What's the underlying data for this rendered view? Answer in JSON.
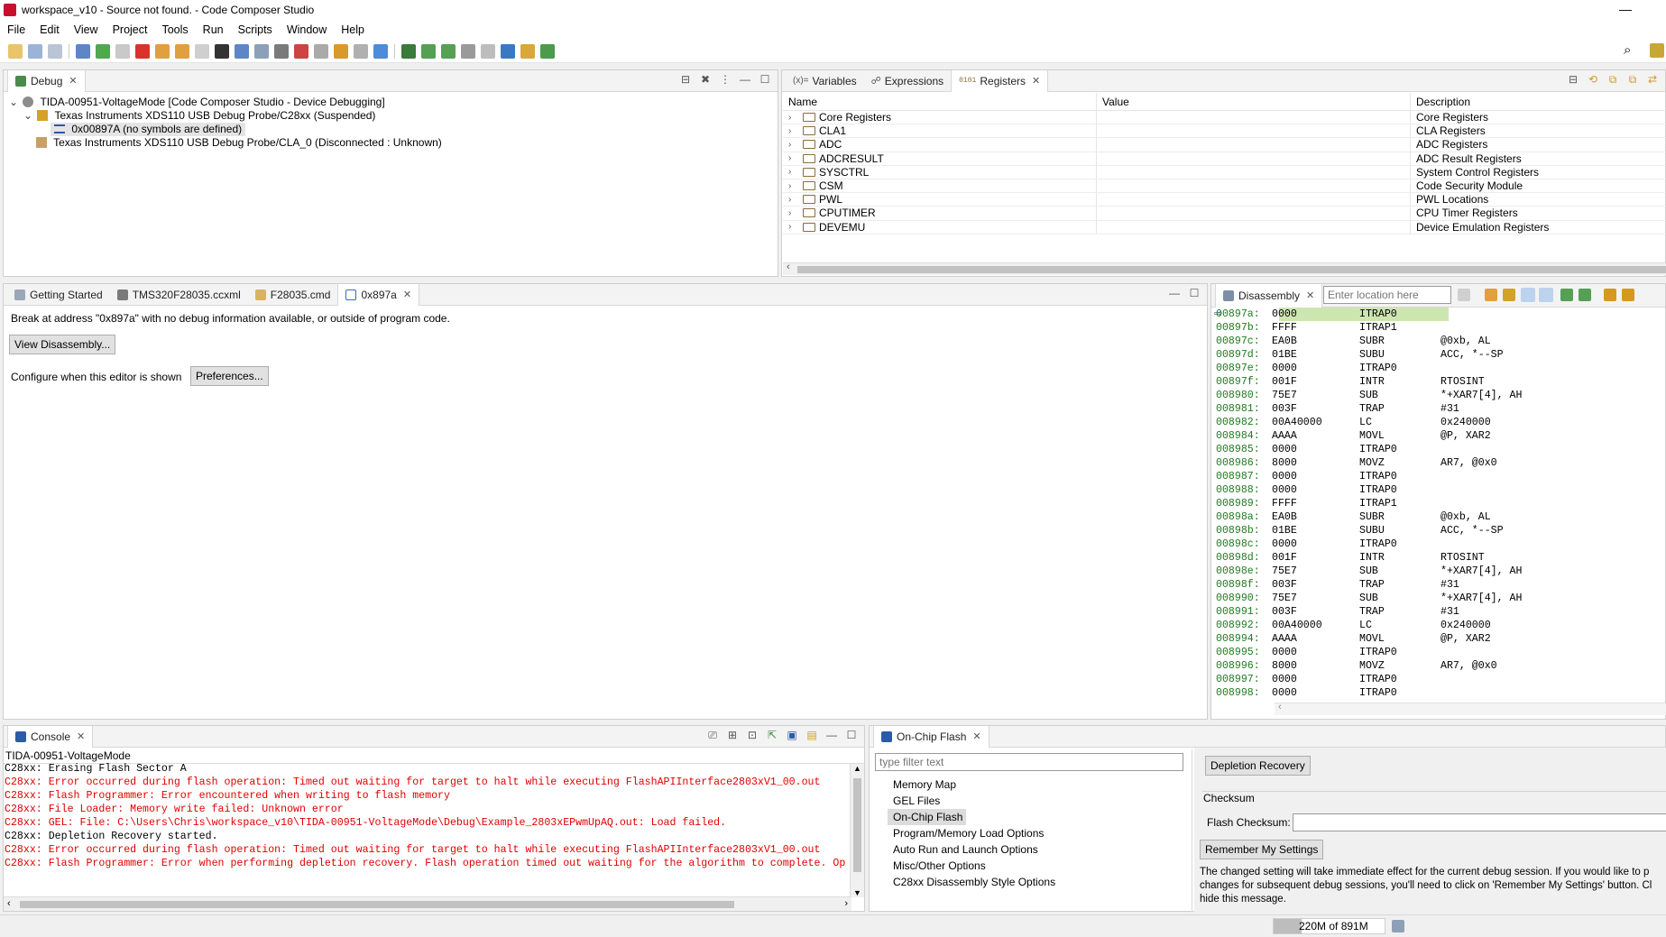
{
  "window": {
    "title": "workspace_v10 - Source not found. - Code Composer Studio",
    "minimize": "—",
    "maximize": "☐",
    "close": "✕"
  },
  "menu": [
    "File",
    "Edit",
    "View",
    "Project",
    "Tools",
    "Run",
    "Scripts",
    "Window",
    "Help"
  ],
  "debug": {
    "tab": "Debug",
    "tree": [
      {
        "label": "TIDA-00951-VoltageMode [Code Composer Studio - Device Debugging]",
        "expander": "⌄"
      },
      {
        "label": "Texas Instruments XDS110 USB Debug Probe/C28xx (Suspended)",
        "expander": "⌄"
      },
      {
        "label": "0x00897A  (no symbols are defined)",
        "expander": ""
      },
      {
        "label": "Texas Instruments XDS110 USB Debug Probe/CLA_0 (Disconnected : Unknown)",
        "expander": ""
      }
    ]
  },
  "registers": {
    "tabs": [
      "Variables",
      "Expressions",
      "Registers"
    ],
    "tab_prefixes": [
      "(x)=",
      "☍",
      "0101"
    ],
    "columns": [
      "Name",
      "Value",
      "Description"
    ],
    "expander": "›",
    "rows": [
      {
        "name": "Core Registers",
        "value": "",
        "desc": "Core Registers"
      },
      {
        "name": "CLA1",
        "value": "",
        "desc": "CLA Registers"
      },
      {
        "name": "ADC",
        "value": "",
        "desc": "ADC Registers"
      },
      {
        "name": "ADCRESULT",
        "value": "",
        "desc": "ADC Result Registers"
      },
      {
        "name": "SYSCTRL",
        "value": "",
        "desc": "System Control Registers"
      },
      {
        "name": "CSM",
        "value": "",
        "desc": "Code Security Module"
      },
      {
        "name": "PWL",
        "value": "",
        "desc": "PWL Locations"
      },
      {
        "name": "CPUTIMER",
        "value": "",
        "desc": "CPU Timer Registers"
      },
      {
        "name": "DEVEMU",
        "value": "",
        "desc": "Device Emulation Registers"
      }
    ]
  },
  "editor": {
    "tabs": [
      "Getting Started",
      "TMS320F28035.ccxml",
      "F28035.cmd",
      "0x897a"
    ],
    "message": "Break at address \"0x897a\" with no debug information available, or outside of program code.",
    "view_disassembly": "View Disassembly...",
    "configure_label": "Configure when this editor is shown",
    "preferences": "Preferences..."
  },
  "disassembly": {
    "tab": "Disassembly",
    "location_placeholder": "Enter location here",
    "pc_marker": "⇨",
    "rows": [
      {
        "addr": "00897a:",
        "op": "0000",
        "mn": "ITRAP0",
        "args": ""
      },
      {
        "addr": "00897b:",
        "op": "FFFF",
        "mn": "ITRAP1",
        "args": ""
      },
      {
        "addr": "00897c:",
        "op": "EA0B",
        "mn": "SUBR",
        "args": "@0xb, AL"
      },
      {
        "addr": "00897d:",
        "op": "01BE",
        "mn": "SUBU",
        "args": "ACC, *--SP"
      },
      {
        "addr": "00897e:",
        "op": "0000",
        "mn": "ITRAP0",
        "args": ""
      },
      {
        "addr": "00897f:",
        "op": "001F",
        "mn": "INTR",
        "args": "RTOSINT"
      },
      {
        "addr": "008980:",
        "op": "75E7",
        "mn": "SUB",
        "args": "*+XAR7[4], AH"
      },
      {
        "addr": "008981:",
        "op": "003F",
        "mn": "TRAP",
        "args": "#31"
      },
      {
        "addr": "008982:",
        "op": "00A40000",
        "mn": "LC",
        "args": "0x240000"
      },
      {
        "addr": "008984:",
        "op": "AAAA",
        "mn": "MOVL",
        "args": "@P, XAR2"
      },
      {
        "addr": "008985:",
        "op": "0000",
        "mn": "ITRAP0",
        "args": ""
      },
      {
        "addr": "008986:",
        "op": "8000",
        "mn": "MOVZ",
        "args": "AR7, @0x0"
      },
      {
        "addr": "008987:",
        "op": "0000",
        "mn": "ITRAP0",
        "args": ""
      },
      {
        "addr": "008988:",
        "op": "0000",
        "mn": "ITRAP0",
        "args": ""
      },
      {
        "addr": "008989:",
        "op": "FFFF",
        "mn": "ITRAP1",
        "args": ""
      },
      {
        "addr": "00898a:",
        "op": "EA0B",
        "mn": "SUBR",
        "args": "@0xb, AL"
      },
      {
        "addr": "00898b:",
        "op": "01BE",
        "mn": "SUBU",
        "args": "ACC, *--SP"
      },
      {
        "addr": "00898c:",
        "op": "0000",
        "mn": "ITRAP0",
        "args": ""
      },
      {
        "addr": "00898d:",
        "op": "001F",
        "mn": "INTR",
        "args": "RTOSINT"
      },
      {
        "addr": "00898e:",
        "op": "75E7",
        "mn": "SUB",
        "args": "*+XAR7[4], AH"
      },
      {
        "addr": "00898f:",
        "op": "003F",
        "mn": "TRAP",
        "args": "#31"
      },
      {
        "addr": "008990:",
        "op": "75E7",
        "mn": "SUB",
        "args": "*+XAR7[4], AH"
      },
      {
        "addr": "008991:",
        "op": "003F",
        "mn": "TRAP",
        "args": "#31"
      },
      {
        "addr": "008992:",
        "op": "00A40000",
        "mn": "LC",
        "args": "0x240000"
      },
      {
        "addr": "008994:",
        "op": "AAAA",
        "mn": "MOVL",
        "args": "@P, XAR2"
      },
      {
        "addr": "008995:",
        "op": "0000",
        "mn": "ITRAP0",
        "args": ""
      },
      {
        "addr": "008996:",
        "op": "8000",
        "mn": "MOVZ",
        "args": "AR7, @0x0"
      },
      {
        "addr": "008997:",
        "op": "0000",
        "mn": "ITRAP0",
        "args": ""
      },
      {
        "addr": "008998:",
        "op": "0000",
        "mn": "ITRAP0",
        "args": ""
      }
    ]
  },
  "console": {
    "tab": "Console",
    "session": "TIDA-00951-VoltageMode",
    "lines": [
      {
        "text": "C28xx: Erasing Flash Sector A",
        "error": false
      },
      {
        "text": "C28xx: Error occurred during flash operation: Timed out waiting for target to halt while executing FlashAPIInterface2803xV1_00.out",
        "error": true
      },
      {
        "text": "C28xx: Flash Programmer: Error encountered when writing to flash memory",
        "error": true
      },
      {
        "text": "C28xx: File Loader: Memory write failed: Unknown error",
        "error": true
      },
      {
        "text": "C28xx: GEL: File: C:\\Users\\Chris\\workspace_v10\\TIDA-00951-VoltageMode\\Debug\\Example_2803xEPwmUpAQ.out: Load failed.",
        "error": true
      },
      {
        "text": "C28xx: Depletion Recovery started.",
        "error": false
      },
      {
        "text": "C28xx: Error occurred during flash operation: Timed out waiting for target to halt while executing FlashAPIInterface2803xV1_00.out",
        "error": true
      },
      {
        "text": "C28xx: Flash Programmer: Error when performing depletion recovery. Flash operation timed out waiting for the algorithm to complete. Op",
        "error": true
      }
    ]
  },
  "flash": {
    "tab": "On-Chip Flash",
    "filter_placeholder": "type filter text",
    "items": [
      "Memory Map",
      "GEL Files",
      "On-Chip Flash",
      "Program/Memory Load Options",
      "Auto Run and Launch Options",
      "Misc/Other Options",
      "C28xx Disassembly Style Options"
    ],
    "selected_index": 2,
    "depletion_recovery": "Depletion Recovery",
    "checksum_heading": "Checksum",
    "flash_checksum_label": "Flash Checksum:",
    "flash_checksum_value": "",
    "remember_settings": "Remember My Settings",
    "note": "The changed setting will take immediate effect for the current debug session.  If you would like to p changes for subsequent debug sessions, you'll need to click on 'Remember My Settings' button. Cl hide this message."
  },
  "status": {
    "heap": "220M of 891M",
    "heap_used_fraction": 0.25
  }
}
